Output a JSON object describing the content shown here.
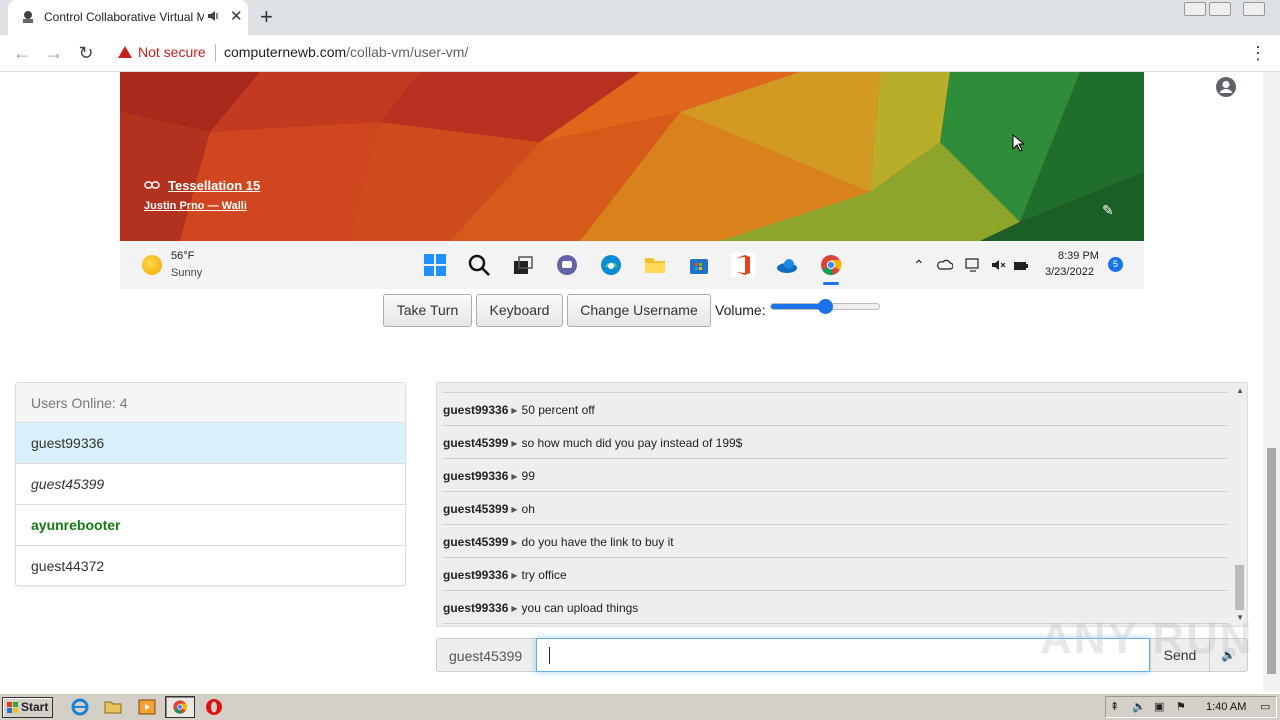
{
  "browser": {
    "tab_title": "Control Collaborative Virtual Ma",
    "security_label": "Not secure",
    "url_domain": "computernewb.com",
    "url_path": "/collab-vm/user-vm/"
  },
  "vm": {
    "wallpaper_title": "Tessellation 15",
    "wallpaper_author": "Justin Prno — Walli",
    "weather_temp": "56°F",
    "weather_condition": "Sunny",
    "time": "8:39 PM",
    "date": "3/23/2022",
    "notification_count": "5",
    "taskbar_icons": [
      "windows-start-icon",
      "search-icon",
      "task-view-icon",
      "teams-chat-icon",
      "edge-icon",
      "file-explorer-icon",
      "store-icon",
      "office-icon",
      "onedrive-icon",
      "chrome-icon"
    ]
  },
  "controls": {
    "take_turn": "Take Turn",
    "keyboard": "Keyboard",
    "change_username": "Change Username",
    "volume_label": "Volume:",
    "volume_level": 0.5
  },
  "users": {
    "header": "Users Online: 4",
    "list": [
      {
        "name": "guest99336",
        "style": "selected"
      },
      {
        "name": "guest45399",
        "style": "italic"
      },
      {
        "name": "ayunrebooter",
        "style": "admin"
      },
      {
        "name": "guest44372",
        "style": "normal"
      }
    ]
  },
  "chat": {
    "messages": [
      {
        "user": "guest99336",
        "text": "50 percent off"
      },
      {
        "user": "guest45399",
        "text": "so how much did you pay instead of 199$"
      },
      {
        "user": "guest99336",
        "text": "99"
      },
      {
        "user": "guest45399",
        "text": "oh"
      },
      {
        "user": "guest45399",
        "text": "do you have the link to buy it"
      },
      {
        "user": "guest99336",
        "text": "try office"
      },
      {
        "user": "guest99336",
        "text": "you can upload things"
      }
    ],
    "username": "guest45399",
    "input_value": "",
    "send_label": "Send"
  },
  "host_taskbar": {
    "start_label": "Start",
    "clock": "1:40 AM"
  },
  "watermark": "ANY RUN",
  "colors": {
    "accent": "#1a73e8",
    "admin_user": "#137a13",
    "selected_row": "#d9f1fb",
    "not_secure": "#c5221f"
  }
}
